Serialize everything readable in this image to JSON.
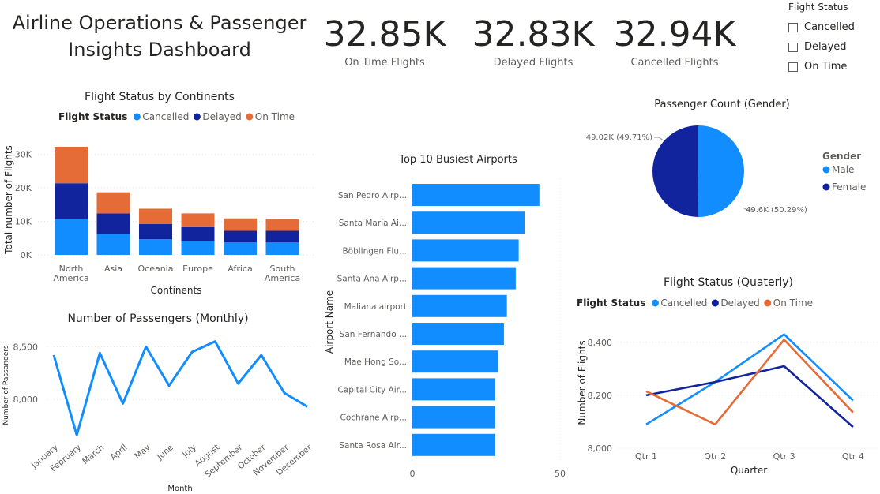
{
  "title": "Airline Operations & Passenger Insights Dashboard",
  "kpis": [
    {
      "value": "32.85K",
      "label": "On Time Flights"
    },
    {
      "value": "32.83K",
      "label": "Delayed Flights"
    },
    {
      "value": "32.94K",
      "label": "Cancelled Flights"
    }
  ],
  "slicer": {
    "title": "Flight Status",
    "options": [
      "Cancelled",
      "Delayed",
      "On Time"
    ]
  },
  "colors": {
    "cancelled": "#118DFF",
    "delayed": "#12239E",
    "on_time": "#E66C37"
  },
  "chart_data": [
    {
      "id": "continents",
      "type": "bar",
      "stacked": true,
      "title": "Flight Status by Continents",
      "legend_title": "Flight Status",
      "legend_position": "top",
      "categories": [
        "North America",
        "Asia",
        "Oceania",
        "Europe",
        "Africa",
        "South America"
      ],
      "series": [
        {
          "name": "Cancelled",
          "values": [
            10700,
            6300,
            4700,
            4200,
            3700,
            3700
          ]
        },
        {
          "name": "Delayed",
          "values": [
            10700,
            6100,
            4500,
            4100,
            3500,
            3500
          ]
        },
        {
          "name": "On Time",
          "values": [
            10900,
            6300,
            4600,
            4100,
            3700,
            3600
          ]
        }
      ],
      "xlabel": "Continents",
      "ylabel": "Total number of Flights",
      "yticks": [
        "0K",
        "10K",
        "20K",
        "30K"
      ],
      "ylim": [
        0,
        33000
      ]
    },
    {
      "id": "monthly",
      "type": "line",
      "title": "Number of Passengers (Monthly)",
      "categories": [
        "January",
        "February",
        "March",
        "April",
        "May",
        "June",
        "July",
        "August",
        "September",
        "October",
        "November",
        "December"
      ],
      "series": [
        {
          "values": [
            8420,
            7660,
            8440,
            7960,
            8500,
            8130,
            8450,
            8550,
            8150,
            8420,
            8060,
            7930
          ]
        }
      ],
      "xlabel": "Month",
      "ylabel": "Number of Passangers",
      "yticks": [
        "8,000",
        "8,500"
      ],
      "ylim": [
        7640,
        8600
      ]
    },
    {
      "id": "airports",
      "type": "bar",
      "orientation": "horizontal",
      "title": "Top 10 Busiest Airports",
      "categories": [
        "San Pedro Airp...",
        "Santa Maria Ai...",
        "Böblingen Flu...",
        "Santa Ana Airp...",
        "Maliana airport",
        "San Fernando ...",
        "Mae Hong So...",
        "Capital City Air...",
        "Cochrane Airp...",
        "Santa Rosa Air..."
      ],
      "values": [
        43,
        38,
        36,
        35,
        32,
        31,
        29,
        28,
        28,
        28
      ],
      "ylabel": "Airport Name",
      "xticks": [
        "0",
        "50"
      ],
      "xlim": [
        0,
        50
      ]
    },
    {
      "id": "gender",
      "type": "pie",
      "title": "Passenger Count (Gender)",
      "legend_title": "Gender",
      "legend_position": "right",
      "labels": [
        "Male",
        "Female"
      ],
      "values": [
        49.6,
        49.02
      ],
      "data_labels": [
        "49.6K (50.29%)",
        "49.02K (49.71%)"
      ]
    },
    {
      "id": "quarterly",
      "type": "line",
      "title": "Flight Status (Quaterly)",
      "legend_title": "Flight Status",
      "legend_position": "top",
      "categories": [
        "Qtr 1",
        "Qtr 2",
        "Qtr 3",
        "Qtr 4"
      ],
      "series": [
        {
          "name": "Cancelled",
          "values": [
            8090,
            8250,
            8430,
            8180
          ]
        },
        {
          "name": "Delayed",
          "values": [
            8200,
            8250,
            8310,
            8080
          ]
        },
        {
          "name": "On Time",
          "values": [
            8215,
            8090,
            8410,
            8135
          ]
        }
      ],
      "xlabel": "Quarter",
      "ylabel": "Number of Flights",
      "yticks": [
        "8,000",
        "8,200",
        "8,400"
      ],
      "ylim": [
        8000,
        8450
      ]
    }
  ]
}
